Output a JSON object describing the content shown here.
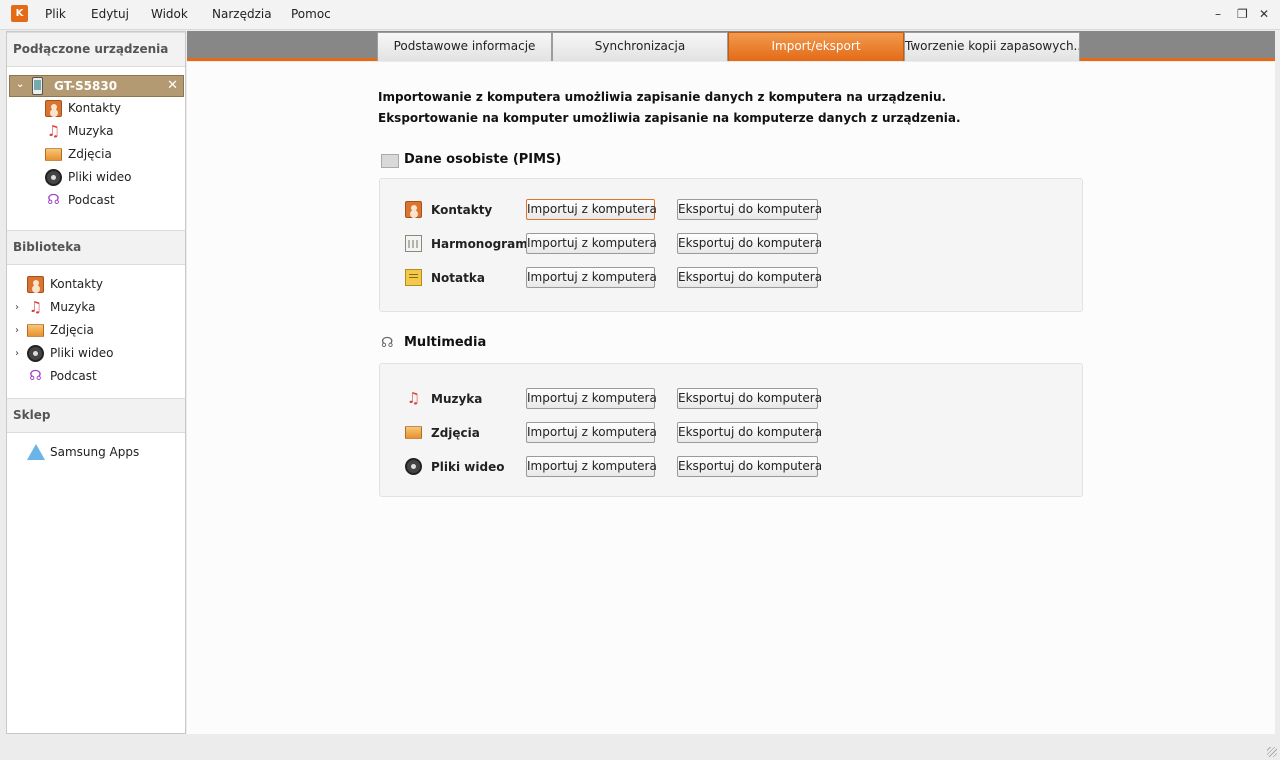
{
  "menu": {
    "items": [
      "Plik",
      "Edytuj",
      "Widok",
      "Narzędzia",
      "Pomoc"
    ],
    "logo": "K"
  },
  "window": {
    "minimize": "–",
    "restore": "❐",
    "close": "✕"
  },
  "sidebar": {
    "connected_header": "Podłączone urządzenia",
    "device": {
      "name": "GT-S5830",
      "close": "✕",
      "chevron": "⌄"
    },
    "device_items": [
      {
        "label": "Kontakty",
        "icon": "contacts-icon"
      },
      {
        "label": "Muzyka",
        "icon": "music-icon"
      },
      {
        "label": "Zdjęcia",
        "icon": "photo-icon"
      },
      {
        "label": "Pliki wideo",
        "icon": "video-icon"
      },
      {
        "label": "Podcast",
        "icon": "podcast-icon"
      }
    ],
    "library_header": "Biblioteka",
    "library_items": [
      {
        "label": "Kontakty",
        "icon": "contacts-icon",
        "expandable": false
      },
      {
        "label": "Muzyka",
        "icon": "music-icon",
        "expandable": true
      },
      {
        "label": "Zdjęcia",
        "icon": "photo-icon",
        "expandable": true
      },
      {
        "label": "Pliki wideo",
        "icon": "video-icon",
        "expandable": true
      },
      {
        "label": "Podcast",
        "icon": "podcast-icon",
        "expandable": false
      }
    ],
    "shop_header": "Sklep",
    "shop_items": [
      {
        "label": "Samsung Apps",
        "icon": "samsung-apps-icon"
      }
    ]
  },
  "tabs": [
    {
      "label": "Podstawowe informacje",
      "active": false
    },
    {
      "label": "Synchronizacja",
      "active": false
    },
    {
      "label": "Import/eksport",
      "active": true
    },
    {
      "label": "Tworzenie kopii zapasowych...",
      "active": false
    }
  ],
  "main": {
    "intro_line1": "Importowanie z komputera umożliwia zapisanie danych z komputera na urządzeniu.",
    "intro_line2": "Eksportowanie na komputer umożliwia zapisanie na komputerze danych z urządzenia.",
    "pims": {
      "title": "Dane osobiste (PIMS)",
      "rows": [
        {
          "label": "Kontakty",
          "icon": "contacts-icon"
        },
        {
          "label": "Harmonogram",
          "icon": "calendar-icon"
        },
        {
          "label": "Notatka",
          "icon": "note-icon"
        }
      ]
    },
    "multimedia": {
      "title": "Multimedia",
      "rows": [
        {
          "label": "Muzyka",
          "icon": "music-icon"
        },
        {
          "label": "Zdjęcia",
          "icon": "photo-icon"
        },
        {
          "label": "Pliki wideo",
          "icon": "video-icon"
        }
      ]
    },
    "import_label": "Importuj z komputera",
    "export_label": "Eksportuj do komputera"
  },
  "colors": {
    "accent": "#e46a16",
    "device_row": "#b49a72"
  }
}
